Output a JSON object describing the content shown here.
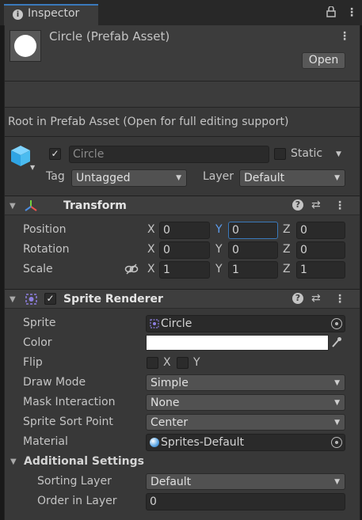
{
  "tab": {
    "icon": "info-icon",
    "label": "Inspector"
  },
  "asset": {
    "title": "Circle (Prefab Asset)",
    "open_label": "Open",
    "info_text": "Root in Prefab Asset (Open for full editing support)"
  },
  "gameobject": {
    "name_value": "Circle",
    "static_label": "Static",
    "tag_label": "Tag",
    "tag_value": "Untagged",
    "layer_label": "Layer",
    "layer_value": "Default"
  },
  "transform": {
    "title": "Transform",
    "rows": [
      {
        "label": "Position",
        "x": "0",
        "y": "0",
        "z": "0"
      },
      {
        "label": "Rotation",
        "x": "0",
        "y": "0",
        "z": "0"
      },
      {
        "label": "Scale",
        "x": "1",
        "y": "1",
        "z": "1"
      }
    ],
    "axes": {
      "x": "X",
      "y": "Y",
      "z": "Z"
    }
  },
  "sprite_renderer": {
    "title": "Sprite Renderer",
    "sprite_label": "Sprite",
    "sprite_value": "Circle",
    "color_label": "Color",
    "color_value": "#ffffff",
    "flip_label": "Flip",
    "flip_x": "X",
    "flip_y": "Y",
    "draw_mode_label": "Draw Mode",
    "draw_mode_value": "Simple",
    "mask_label": "Mask Interaction",
    "mask_value": "None",
    "sort_point_label": "Sprite Sort Point",
    "sort_point_value": "Center",
    "material_label": "Material",
    "material_value": "Sprites-Default",
    "additional_label": "Additional Settings",
    "sorting_layer_label": "Sorting Layer",
    "sorting_layer_value": "Default",
    "order_label": "Order in Layer",
    "order_value": "0"
  },
  "colors": {
    "accent": "#3a79bb",
    "panel": "#383838",
    "header": "#3e3e3e"
  }
}
